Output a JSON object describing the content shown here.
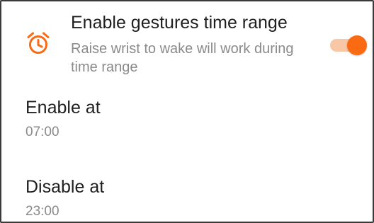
{
  "gesture": {
    "title": "Enable gestures time range",
    "description": "Raise wrist to wake will work during time range",
    "icon": "alarm-clock-icon",
    "enabled": true
  },
  "enable_at": {
    "label": "Enable at",
    "value": "07:00"
  },
  "disable_at": {
    "label": "Disable at",
    "value": "23:00"
  },
  "colors": {
    "accent": "#f96a12",
    "accent_track": "#f7c7a6",
    "primary_text": "#1f1f1f",
    "secondary_text": "#8a8a8a"
  }
}
